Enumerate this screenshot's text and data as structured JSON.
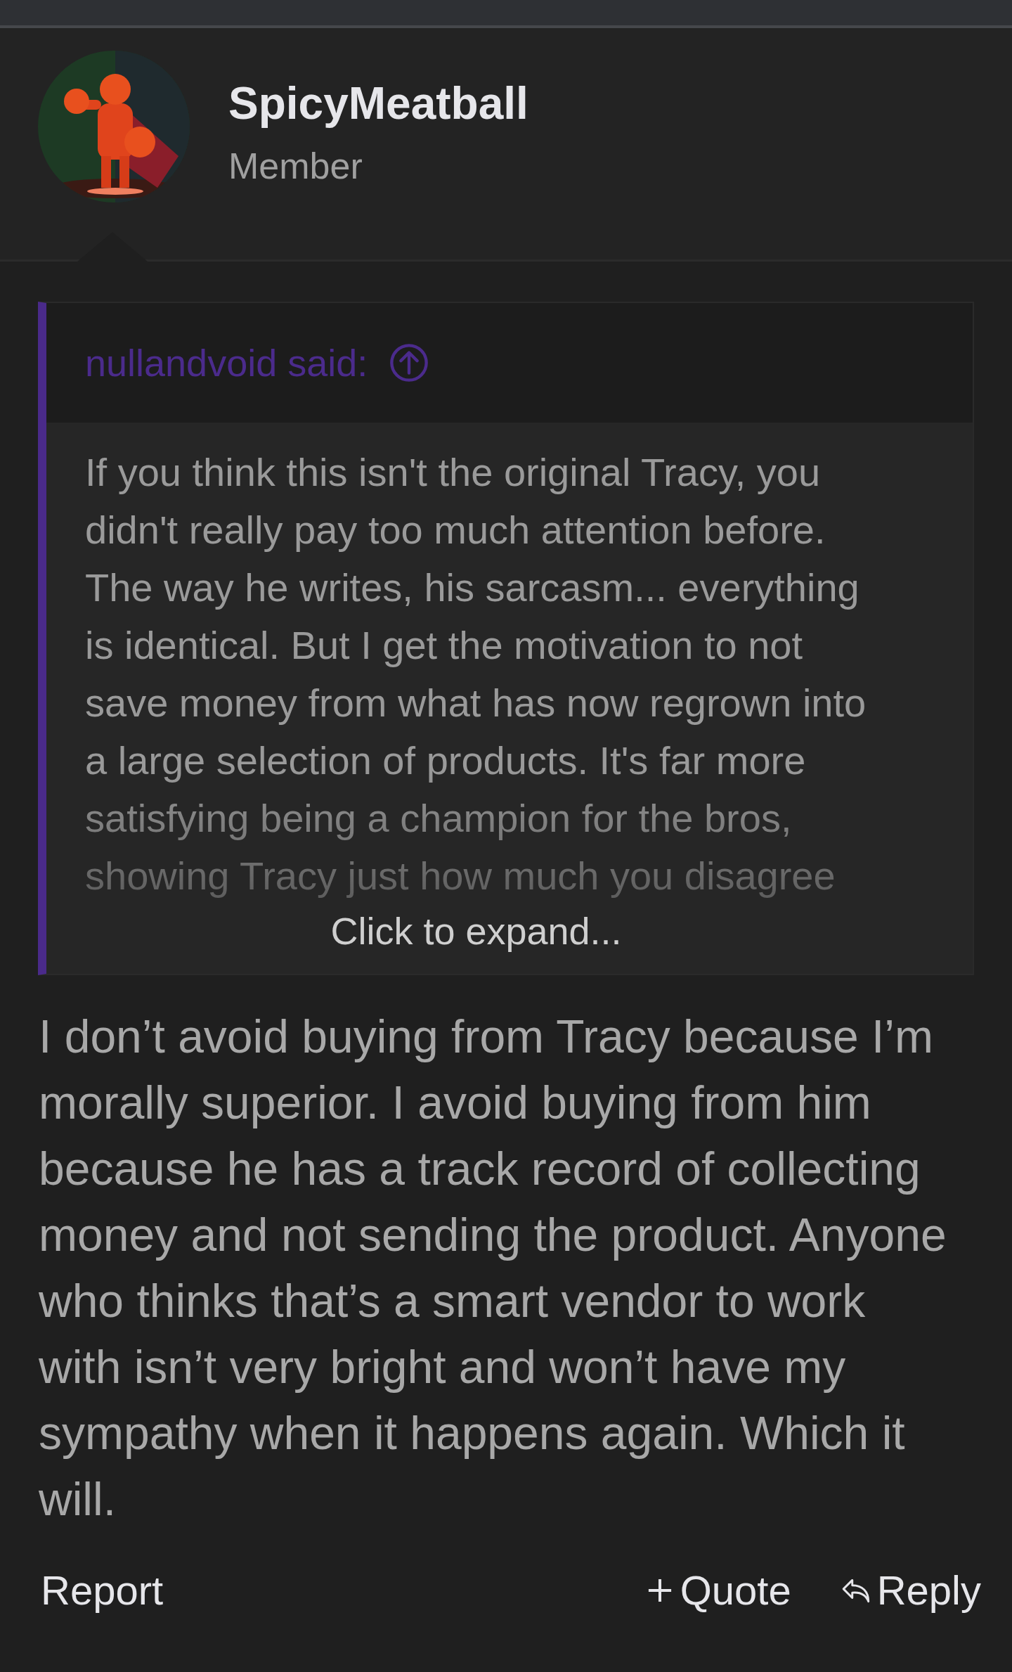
{
  "post": {
    "author": {
      "name": "SpicyMeatball",
      "title": "Member"
    },
    "quote": {
      "attribution": "nullandvoid said:",
      "text": "If you think this isn't the original Tracy, you didn't really pay too much attention before. The way he writes, his sarcasm... everything is identical. But I get the motivation to not save money from what has now regrown into a large selection of products. It's far more satisfying being a champion for the bros, showing Tracy just how much you disagree",
      "expand_label": "Click to expand..."
    },
    "body": "I don’t avoid buying from Tracy because I’m morally superior. I avoid buying from him because he has a track record of collecting money and not sending the product. Anyone who thinks that’s a smart vendor to work with isn’t very bright and won’t have my sympathy when it happens again. Which it will.",
    "actions": [
      {
        "label": "Report",
        "kind": "report"
      },
      {
        "label": "Quote",
        "kind": "quote"
      },
      {
        "label": "Reply",
        "kind": "reply"
      }
    ]
  }
}
